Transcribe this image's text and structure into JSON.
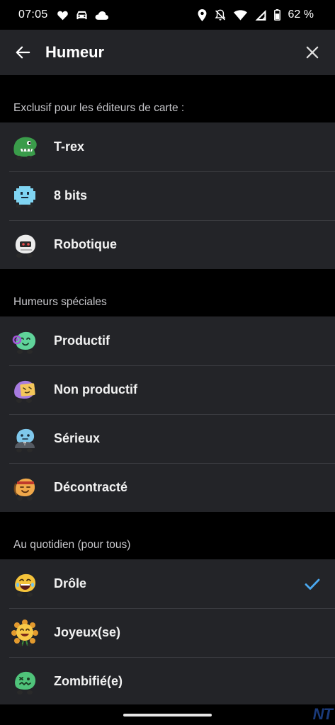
{
  "status_bar": {
    "time": "07:05",
    "left_icons": [
      "heart-icon",
      "car-icon",
      "cloud-icon"
    ],
    "right_icons": [
      "location-icon",
      "notifications-off-icon",
      "wifi-icon",
      "signal-icon",
      "battery-icon"
    ],
    "battery_percent": "62 %"
  },
  "app_bar": {
    "title": "Humeur",
    "back_icon": "arrow-left-icon",
    "close_icon": "close-icon"
  },
  "sections": [
    {
      "header": "Exclusif pour les éditeurs de carte :",
      "items": [
        {
          "label": "T-rex",
          "icon": "trex-mood-icon",
          "color": "#3a9c4a"
        },
        {
          "label": "8 bits",
          "icon": "pixel-ghost-mood-icon",
          "color": "#7fd4f2"
        },
        {
          "label": "Robotique",
          "icon": "robot-mood-icon",
          "color": "#e8e8e8"
        }
      ]
    },
    {
      "header": "Humeurs spéciales",
      "items": [
        {
          "label": "Productif",
          "icon": "headset-mood-icon",
          "color": "#5fd39a"
        },
        {
          "label": "Non productif",
          "icon": "sleepy-mood-icon",
          "color": "#a77be0"
        },
        {
          "label": "Sérieux",
          "icon": "suit-mood-icon",
          "color": "#7fc8ec"
        },
        {
          "label": "Décontracté",
          "icon": "relaxed-mood-icon",
          "color": "#f0a84a"
        }
      ]
    },
    {
      "header": "Au quotidien (pour tous)",
      "items": [
        {
          "label": "Drôle",
          "icon": "laughing-mood-icon",
          "color": "#f5c33b",
          "selected": true
        },
        {
          "label": "Joyeux(se)",
          "icon": "flower-mood-icon",
          "color": "#f7c948"
        },
        {
          "label": "Zombifié(e)",
          "icon": "zombie-mood-icon",
          "color": "#4fc37a"
        }
      ]
    }
  ],
  "accent_color": "#4aa8f0",
  "watermark": "NT"
}
